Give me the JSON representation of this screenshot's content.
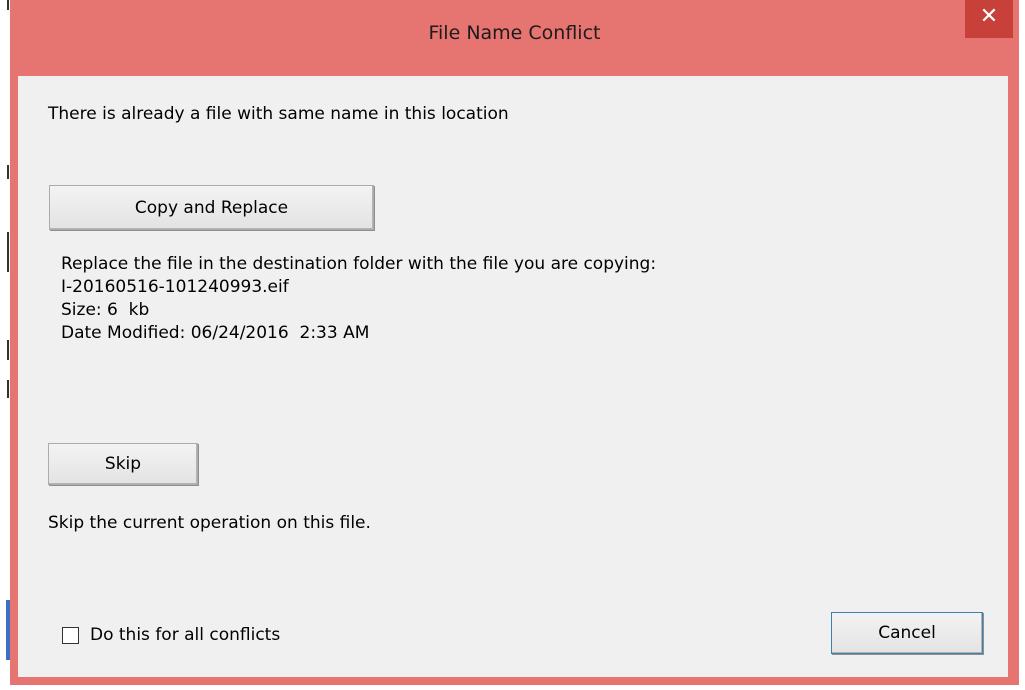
{
  "window": {
    "title": "File Name Conflict",
    "close_glyph": "✕"
  },
  "message": "There is already a file with same name in this location",
  "copy_replace": {
    "label": "Copy and Replace",
    "description": "Replace the file in the destination folder with the file you are copying:",
    "file_name": "I-20160516-101240993.eif",
    "size": "Size: 6  kb",
    "date_modified": "Date Modified: 06/24/2016  2:33 AM"
  },
  "skip": {
    "label": "Skip",
    "description": "Skip the current operation on this file."
  },
  "all_conflicts": {
    "label": "Do this for all conflicts",
    "checked": false
  },
  "cancel": {
    "label": "Cancel"
  },
  "colors": {
    "title_bar": "#e67470",
    "close_button": "#c7403a",
    "client_bg": "#f0f0f0"
  }
}
